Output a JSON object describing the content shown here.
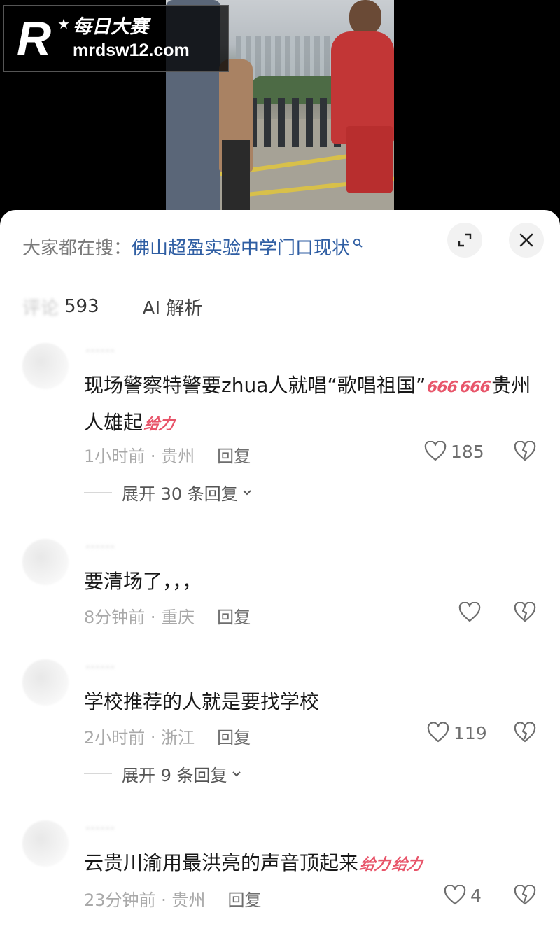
{
  "watermark": {
    "mark": "R",
    "cn": "每日大赛",
    "url": "mrdsw12.com"
  },
  "header": {
    "search_prefix": "大家都在搜：",
    "search_term": "佛山超盈实验中学门口现状",
    "expand_icon": "expand-icon",
    "close_icon": "close-icon"
  },
  "tabs": {
    "comments_label": "评论",
    "comments_count": "593",
    "ai": "AI 解析"
  },
  "comments": [
    {
      "text_a": "现场警察特警要zhua人就唱“歌唱祖国”",
      "emoji_a": "666",
      "emoji_b": "666",
      "text_b": "贵州人雄起",
      "emoji_c": "给力",
      "time": "1小时前 · 贵州",
      "reply": "回复",
      "likes": "185",
      "expand": "展开 30 条回复"
    },
    {
      "text": "要清场了，，，",
      "time": "8分钟前 · 重庆",
      "reply": "回复",
      "likes": ""
    },
    {
      "text": "学校推荐的人就是要找学校",
      "time": "2小时前 · 浙江",
      "reply": "回复",
      "likes": "119",
      "expand": "展开 9 条回复"
    },
    {
      "text": "云贵川渝用最洪亮的声音顶起来",
      "emoji_a": "给力",
      "emoji_b": "给力",
      "time": "23分钟前 · 贵州",
      "reply": "回复",
      "likes": "4"
    }
  ]
}
